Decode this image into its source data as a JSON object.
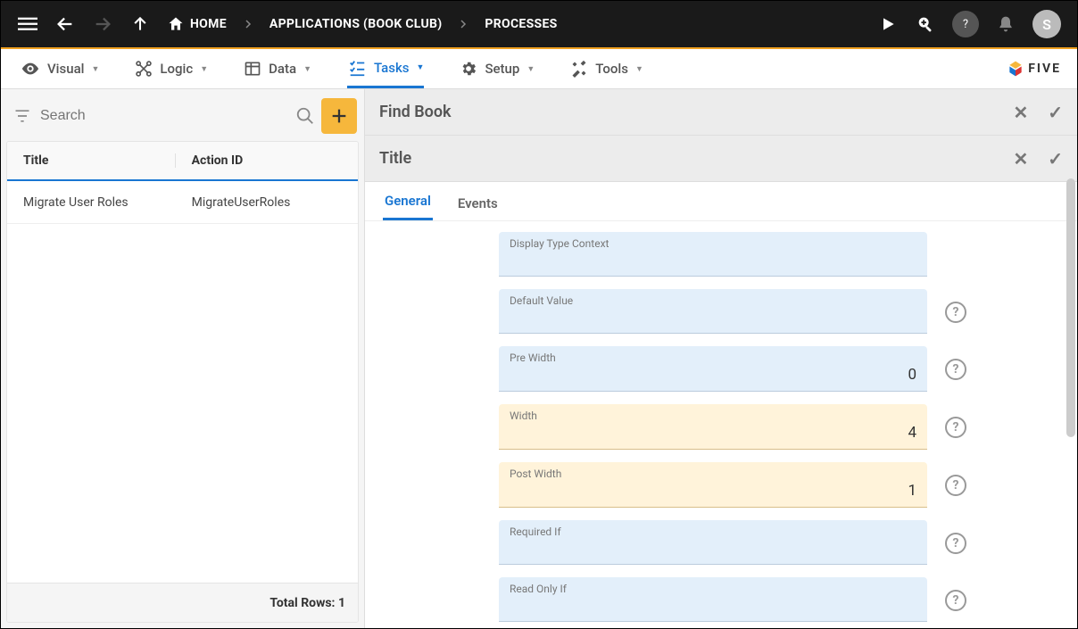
{
  "topbar": {
    "home": "HOME",
    "crumb1": "APPLICATIONS (BOOK CLUB)",
    "crumb2": "PROCESSES",
    "avatar": "S"
  },
  "secnav": {
    "items": [
      {
        "label": "Visual"
      },
      {
        "label": "Logic"
      },
      {
        "label": "Data"
      },
      {
        "label": "Tasks",
        "active": true
      },
      {
        "label": "Setup"
      },
      {
        "label": "Tools"
      }
    ],
    "brand": "FIVE"
  },
  "search": {
    "placeholder": "Search"
  },
  "table": {
    "col1": "Title",
    "col2": "Action ID",
    "rows": [
      {
        "title": "Migrate User Roles",
        "actionId": "MigrateUserRoles"
      }
    ],
    "footer": "Total Rows: 1"
  },
  "rightpanel": {
    "header1": "Find Book",
    "header2": "Title",
    "tabs": [
      {
        "label": "General",
        "active": true
      },
      {
        "label": "Events"
      }
    ],
    "fields": [
      {
        "label": "Display Type Context",
        "value": "",
        "help": false,
        "highlight": false
      },
      {
        "label": "Default Value",
        "value": "",
        "help": true,
        "highlight": false
      },
      {
        "label": "Pre Width",
        "value": "0",
        "help": true,
        "highlight": false
      },
      {
        "label": "Width",
        "value": "4",
        "help": true,
        "highlight": true
      },
      {
        "label": "Post Width",
        "value": "1",
        "help": true,
        "highlight": true
      },
      {
        "label": "Required If",
        "value": "",
        "help": true,
        "highlight": false
      },
      {
        "label": "Read Only If",
        "value": "",
        "help": true,
        "highlight": false
      }
    ]
  }
}
